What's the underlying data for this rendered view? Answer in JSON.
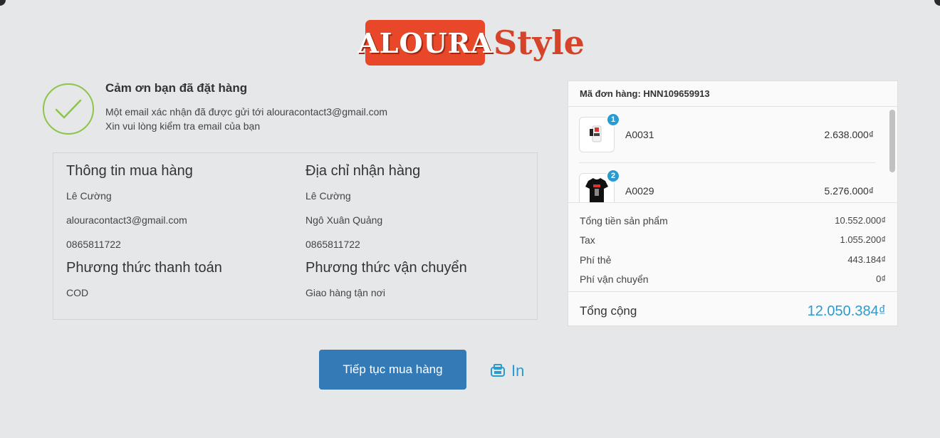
{
  "logo": {
    "brand": "ALOURA",
    "suffix": "Style"
  },
  "thanks": {
    "title": "Cảm ơn bạn đã đặt hàng",
    "line1": "Một email xác nhận đã được gửi tới alouracontact3@gmail.com",
    "line2": "Xin vui lòng kiểm tra email của bạn"
  },
  "buyer_info": {
    "heading": "Thông tin mua hàng",
    "name": "Lê Cường",
    "email": "alouracontact3@gmail.com",
    "phone": "0865811722"
  },
  "shipping_address": {
    "heading": "Địa chỉ nhận hàng",
    "name": "Lê Cường",
    "street": "Ngô Xuân Quảng",
    "phone": "0865811722"
  },
  "payment": {
    "heading": "Phương thức thanh toán",
    "value": "COD"
  },
  "shipping_method": {
    "heading": "Phương thức vận chuyển",
    "value": "Giao hàng tận nơi"
  },
  "order": {
    "code_label": "Mã đơn hàng: HNN109659913",
    "items": [
      {
        "name": "A0031",
        "qty": "1",
        "price": "2.638.000₫"
      },
      {
        "name": "A0029",
        "qty": "2",
        "price": "5.276.000₫"
      }
    ],
    "totals": [
      {
        "label": "Tổng tiền sản phẩm",
        "value": "10.552.000₫"
      },
      {
        "label": "Tax",
        "value": "1.055.200₫"
      },
      {
        "label": "Phí thẻ",
        "value": "443.184₫"
      },
      {
        "label": "Phí vận chuyển",
        "value": "0₫"
      }
    ],
    "grand_label": "Tổng cộng",
    "grand_value": "12.050.384₫"
  },
  "actions": {
    "continue_label": "Tiếp tục mua hàng",
    "print_label": "In"
  },
  "colors": {
    "accent": "#2a9bd1",
    "button": "#337ab7",
    "brand": "#e8472a",
    "success": "#8dc54a"
  }
}
